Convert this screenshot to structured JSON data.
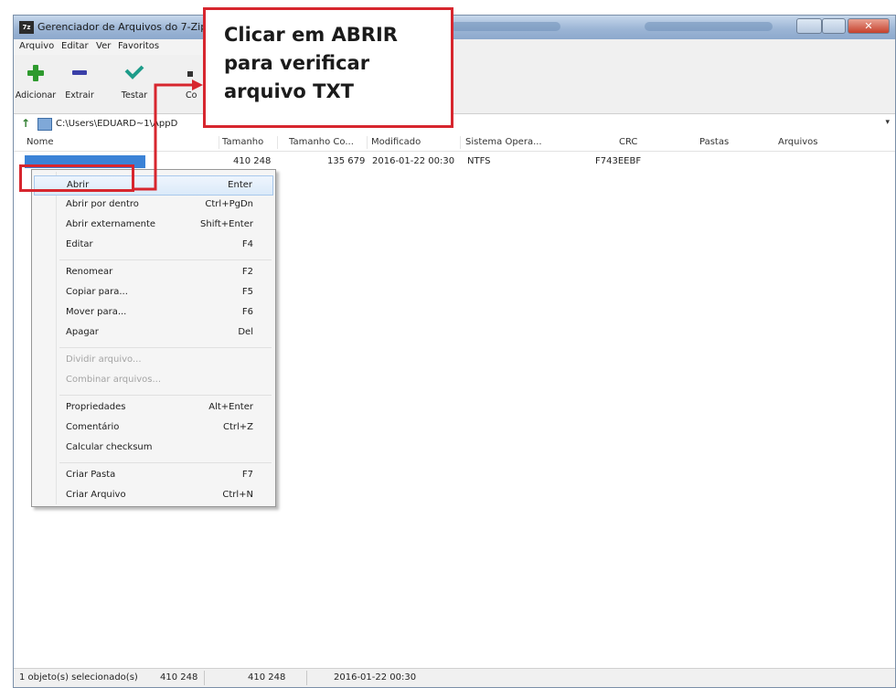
{
  "window": {
    "title": "Gerenciador de Arquivos do 7-Zip",
    "close_glyph": "✕"
  },
  "menubar": [
    "Arquivo",
    "Editar",
    "Ver",
    "Favoritos"
  ],
  "toolbar": {
    "buttons": [
      {
        "label": "Adicionar",
        "icon": "plus-icon",
        "color": "#2e9a2e"
      },
      {
        "label": "Extrair",
        "icon": "minus-icon",
        "color": "#3a3fa8"
      },
      {
        "label": "Testar",
        "icon": "check-icon",
        "color": "#1e9c8a"
      },
      {
        "label": "Co",
        "icon": "copy-icon",
        "color": "#333333"
      }
    ]
  },
  "address": {
    "up_glyph": "↑",
    "path": "C:\\Users\\EDUARD~1\\AppD",
    "dropdown_glyph": "▾"
  },
  "columns": [
    "Nome",
    "Tamanho",
    "Tamanho Co...",
    "Modificado",
    "Sistema Opera...",
    "CRC",
    "Pastas",
    "Arquivos"
  ],
  "file_row": {
    "name": "",
    "size": "410 248",
    "packed_size": "135 679",
    "modified": "2016-01-22 00:30",
    "host_os": "NTFS",
    "crc": "F743EEBF"
  },
  "context_menu": [
    {
      "label": "Abrir",
      "shortcut": "Enter",
      "highlighted": true
    },
    {
      "label": "Abrir por dentro",
      "shortcut": "Ctrl+PgDn"
    },
    {
      "label": "Abrir externamente",
      "shortcut": "Shift+Enter"
    },
    {
      "label": "Editar",
      "shortcut": "F4"
    },
    {
      "label": "Renomear",
      "shortcut": "F2"
    },
    {
      "label": "Copiar para...",
      "shortcut": "F5"
    },
    {
      "label": "Mover para...",
      "shortcut": "F6"
    },
    {
      "label": "Apagar",
      "shortcut": "Del"
    },
    {
      "label": "Dividir arquivo...",
      "shortcut": "",
      "disabled": true
    },
    {
      "label": "Combinar arquivos...",
      "shortcut": "",
      "disabled": true
    },
    {
      "label": "Propriedades",
      "shortcut": "Alt+Enter"
    },
    {
      "label": "Comentário",
      "shortcut": "Ctrl+Z"
    },
    {
      "label": "Calcular checksum",
      "shortcut": ""
    },
    {
      "label": "Criar Pasta",
      "shortcut": "F7"
    },
    {
      "label": "Criar Arquivo",
      "shortcut": "Ctrl+N"
    }
  ],
  "statusbar": {
    "selected": "1 objeto(s) selecionado(s)",
    "size1": "410 248",
    "size2": "410 248",
    "date": "2016-01-22 00:30"
  },
  "annotation": {
    "text": "Clicar em ABRIR\npara verificar\narquivo TXT",
    "arrow_color": "#d7262e"
  }
}
